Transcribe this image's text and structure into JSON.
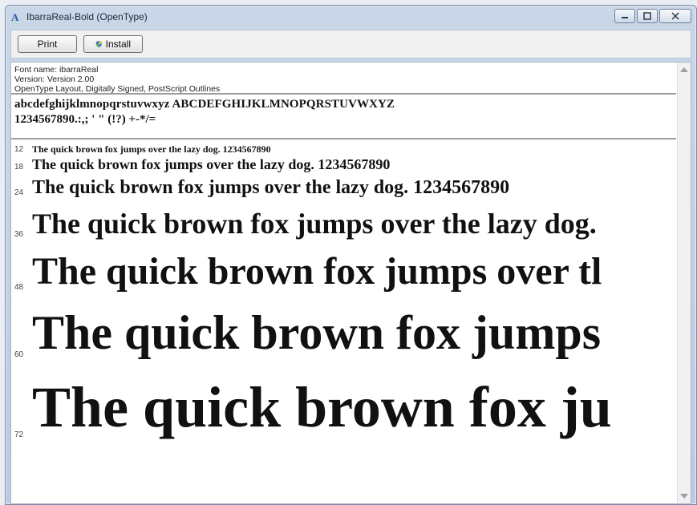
{
  "window": {
    "title": "IbarraReal-Bold (OpenType)"
  },
  "toolbar": {
    "print_label": "Print",
    "install_label": "Install"
  },
  "font_info": {
    "name": "Font name: ibarraReal",
    "version": "Version: Version 2.00",
    "features": "OpenType Layout, Digitally Signed, PostScript Outlines"
  },
  "charset": {
    "line1": "abcdefghijklmnopqrstuvwxyz ABCDEFGHIJKLMNOPQRSTUVWXYZ",
    "line2": "1234567890.:,; ' \" (!?) +-*/="
  },
  "samples": [
    {
      "size": "12",
      "text": "The quick brown fox jumps over the lazy dog. 1234567890"
    },
    {
      "size": "18",
      "text": "The quick brown fox jumps over the lazy dog. 1234567890"
    },
    {
      "size": "24",
      "text": "The quick brown fox jumps over the lazy dog. 1234567890"
    },
    {
      "size": "36",
      "text": "The quick brown fox jumps over the lazy dog."
    },
    {
      "size": "48",
      "text": "The quick brown fox jumps over tl"
    },
    {
      "size": "60",
      "text": "The quick brown fox jumps"
    },
    {
      "size": "72",
      "text": "The quick brown fox ju"
    }
  ],
  "icons": {
    "title_icon": "font-viewer-icon",
    "install_icon": "shield-icon"
  }
}
